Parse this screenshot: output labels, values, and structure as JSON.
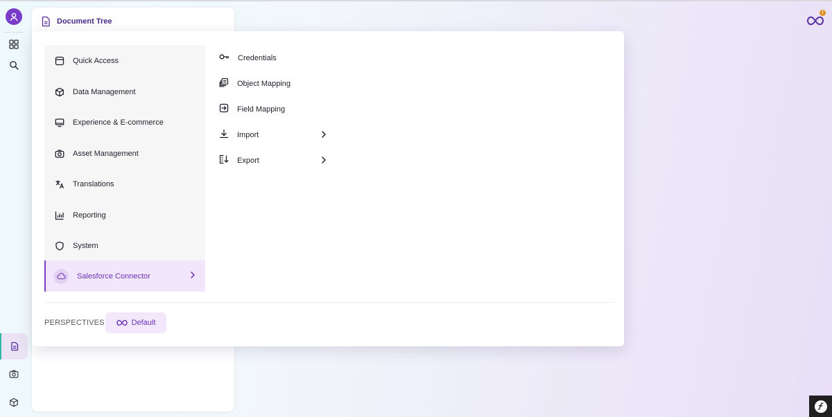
{
  "panel": {
    "title": "Document Tree"
  },
  "main_menu": {
    "items": [
      {
        "label": "Quick Access",
        "icon": "window-icon"
      },
      {
        "label": "Data Management",
        "icon": "cube-icon"
      },
      {
        "label": "Experience & E-commerce",
        "icon": "monitor-icon"
      },
      {
        "label": "Asset Management",
        "icon": "camera-icon"
      },
      {
        "label": "Translations",
        "icon": "translate-icon"
      },
      {
        "label": "Reporting",
        "icon": "bar-chart-icon"
      },
      {
        "label": "System",
        "icon": "shield-icon"
      },
      {
        "label": "Salesforce Connector",
        "icon": "cloud-icon",
        "active": true
      }
    ]
  },
  "submenu": {
    "items": [
      {
        "label": "Credentials",
        "icon": "key-icon"
      },
      {
        "label": "Object Mapping",
        "icon": "layers-icon"
      },
      {
        "label": "Field Mapping",
        "icon": "arrow-in-box-icon"
      },
      {
        "label": "Import",
        "icon": "download-icon",
        "has_children": true
      },
      {
        "label": "Export",
        "icon": "export-list-icon",
        "has_children": true
      }
    ]
  },
  "perspectives": {
    "label": "PERSPECTIVES",
    "current": "Default"
  },
  "brand": {
    "badge": "!"
  },
  "colors": {
    "accent": "#7a3cc8",
    "active_bg": "#f1e6fb",
    "warning": "#e0901f",
    "teal": "#2fb7a3"
  }
}
